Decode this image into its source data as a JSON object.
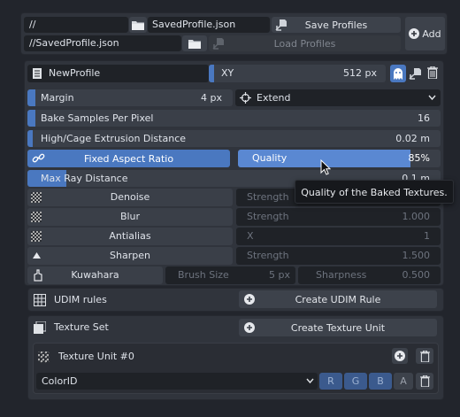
{
  "top": {
    "path_value": "//",
    "profile_file": "SavedProfile.json",
    "save_label": "Save Profiles",
    "add_label": "Add",
    "path2_value": "//SavedProfile.json",
    "load_label": "Load Profiles"
  },
  "profile": {
    "name": "NewProfile",
    "axis_label": "XY",
    "size_value": "512 px"
  },
  "settings": {
    "margin_label": "Margin",
    "margin_value": "4 px",
    "extend_label": "Extend",
    "bake_samples_label": "Bake Samples Per Pixel",
    "bake_samples_value": "16",
    "cage_label": "High/Cage Extrusion Distance",
    "cage_value": "0.02 m",
    "fixed_aspect_label": "Fixed Aspect Ratio",
    "quality_label": "Quality",
    "quality_value": "85%",
    "max_ray_label": "Max Ray Distance",
    "max_ray_value": "0.1 m"
  },
  "tooltip": {
    "text": "Quality of the Baked Textures."
  },
  "filters": [
    {
      "name": "Denoise",
      "param": "Strength",
      "value": ""
    },
    {
      "name": "Blur",
      "param": "Strength",
      "value": "1.000"
    },
    {
      "name": "Antialias",
      "param": "X",
      "value": "1"
    },
    {
      "name": "Sharpen",
      "param": "Strength",
      "value": "1.500"
    }
  ],
  "kuwahara": {
    "name": "Kuwahara",
    "brush_label": "Brush Size",
    "brush_value": "5 px",
    "sharp_label": "Sharpness",
    "sharp_value": "0.500"
  },
  "udim": {
    "label": "UDIM rules",
    "create_label": "Create UDIM Rule"
  },
  "texture_set": {
    "label": "Texture Set",
    "create_label": "Create Texture Unit"
  },
  "unit": {
    "label": "Texture Unit #0",
    "channel": "ColorID",
    "channels": [
      "R",
      "G",
      "B",
      "A"
    ]
  },
  "colors": {
    "accent": "#4a78c0",
    "panel": "#30343c",
    "field": "#1f2227"
  }
}
